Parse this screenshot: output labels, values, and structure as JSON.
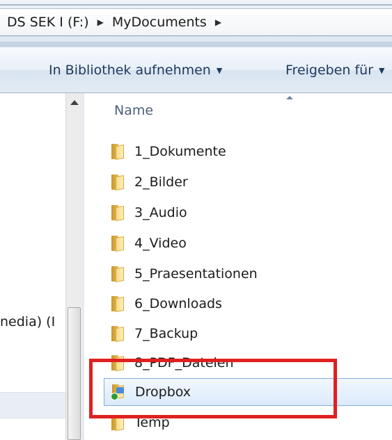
{
  "address_bar": {
    "crumbs": [
      "DS SEK I (F:)",
      "MyDocuments"
    ]
  },
  "command_bar": {
    "library_label": "In Bibliothek aufnehmen",
    "share_label": "Freigeben für"
  },
  "nav_pane": {
    "partial_item": "nedia) (I"
  },
  "file_list": {
    "column_name": "Name",
    "items": [
      {
        "label": "1_Dokumente",
        "icon": "folder-icon"
      },
      {
        "label": "2_Bilder",
        "icon": "folder-icon"
      },
      {
        "label": "3_Audio",
        "icon": "folder-icon"
      },
      {
        "label": "4_Video",
        "icon": "folder-icon"
      },
      {
        "label": "5_Praesentationen",
        "icon": "folder-icon"
      },
      {
        "label": "6_Downloads",
        "icon": "folder-icon"
      },
      {
        "label": "7_Backup",
        "icon": "folder-icon"
      },
      {
        "label": "8_PDF_Dateien",
        "icon": "folder-icon"
      },
      {
        "label": "Dropbox",
        "icon": "dropbox-folder-icon",
        "selected": true
      },
      {
        "label": "Temp",
        "icon": "folder-icon"
      }
    ]
  },
  "colors": {
    "highlight_box": "#e02020",
    "selection": "#dbeafc"
  }
}
